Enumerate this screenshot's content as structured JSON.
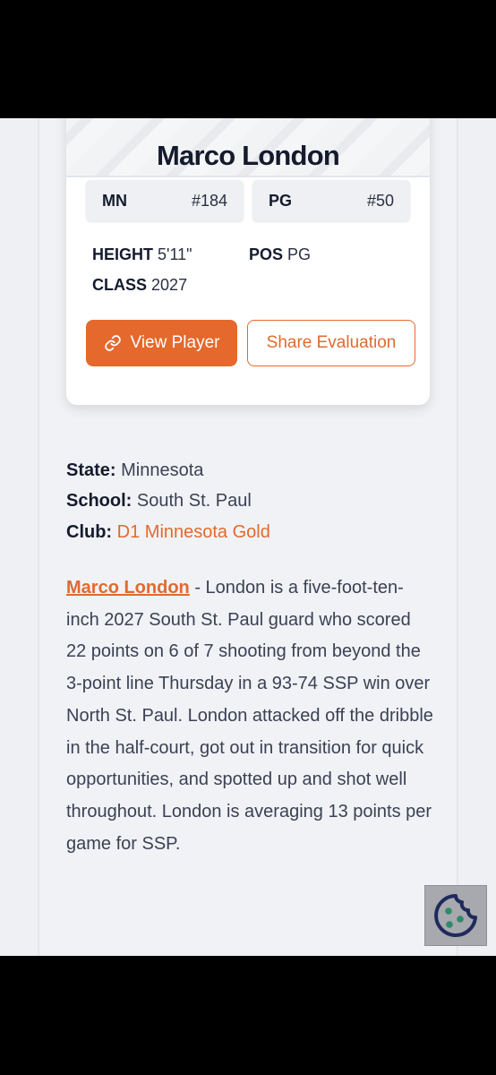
{
  "player": {
    "name": "Marco London",
    "state_rank": {
      "label": "MN",
      "value": "#184"
    },
    "position_rank": {
      "label": "PG",
      "value": "#50"
    },
    "height": {
      "label": "HEIGHT",
      "value": "5'11\""
    },
    "position": {
      "label": "POS",
      "value": "PG"
    },
    "class": {
      "label": "CLASS",
      "value": "2027"
    }
  },
  "buttons": {
    "view_player": "View Player",
    "share_evaluation": "Share Evaluation"
  },
  "info": {
    "state_label": "State:",
    "state_value": "Minnesota",
    "school_label": "School:",
    "school_value": "South St. Paul",
    "club_label": "Club:",
    "club_value": "D1 Minnesota Gold"
  },
  "evaluation": {
    "name_link": "Marco London",
    "text": " - London is a five-foot-ten-inch 2027 South St. Paul guard who scored 22 points on 6 of 7 shooting from beyond the 3-point line Thursday in a 93-74 SSP win over North St. Paul. London attacked off the dribble in the half-court, got out in transition for quick opportunities, and spotted up and shot well throughout. London is averaging 13 points per game for SSP."
  },
  "colors": {
    "accent": "#e5682c",
    "text": "#151b2d",
    "muted": "#3b4154"
  },
  "icons": {
    "view_player": "link-icon",
    "cookie": "cookie-icon"
  }
}
